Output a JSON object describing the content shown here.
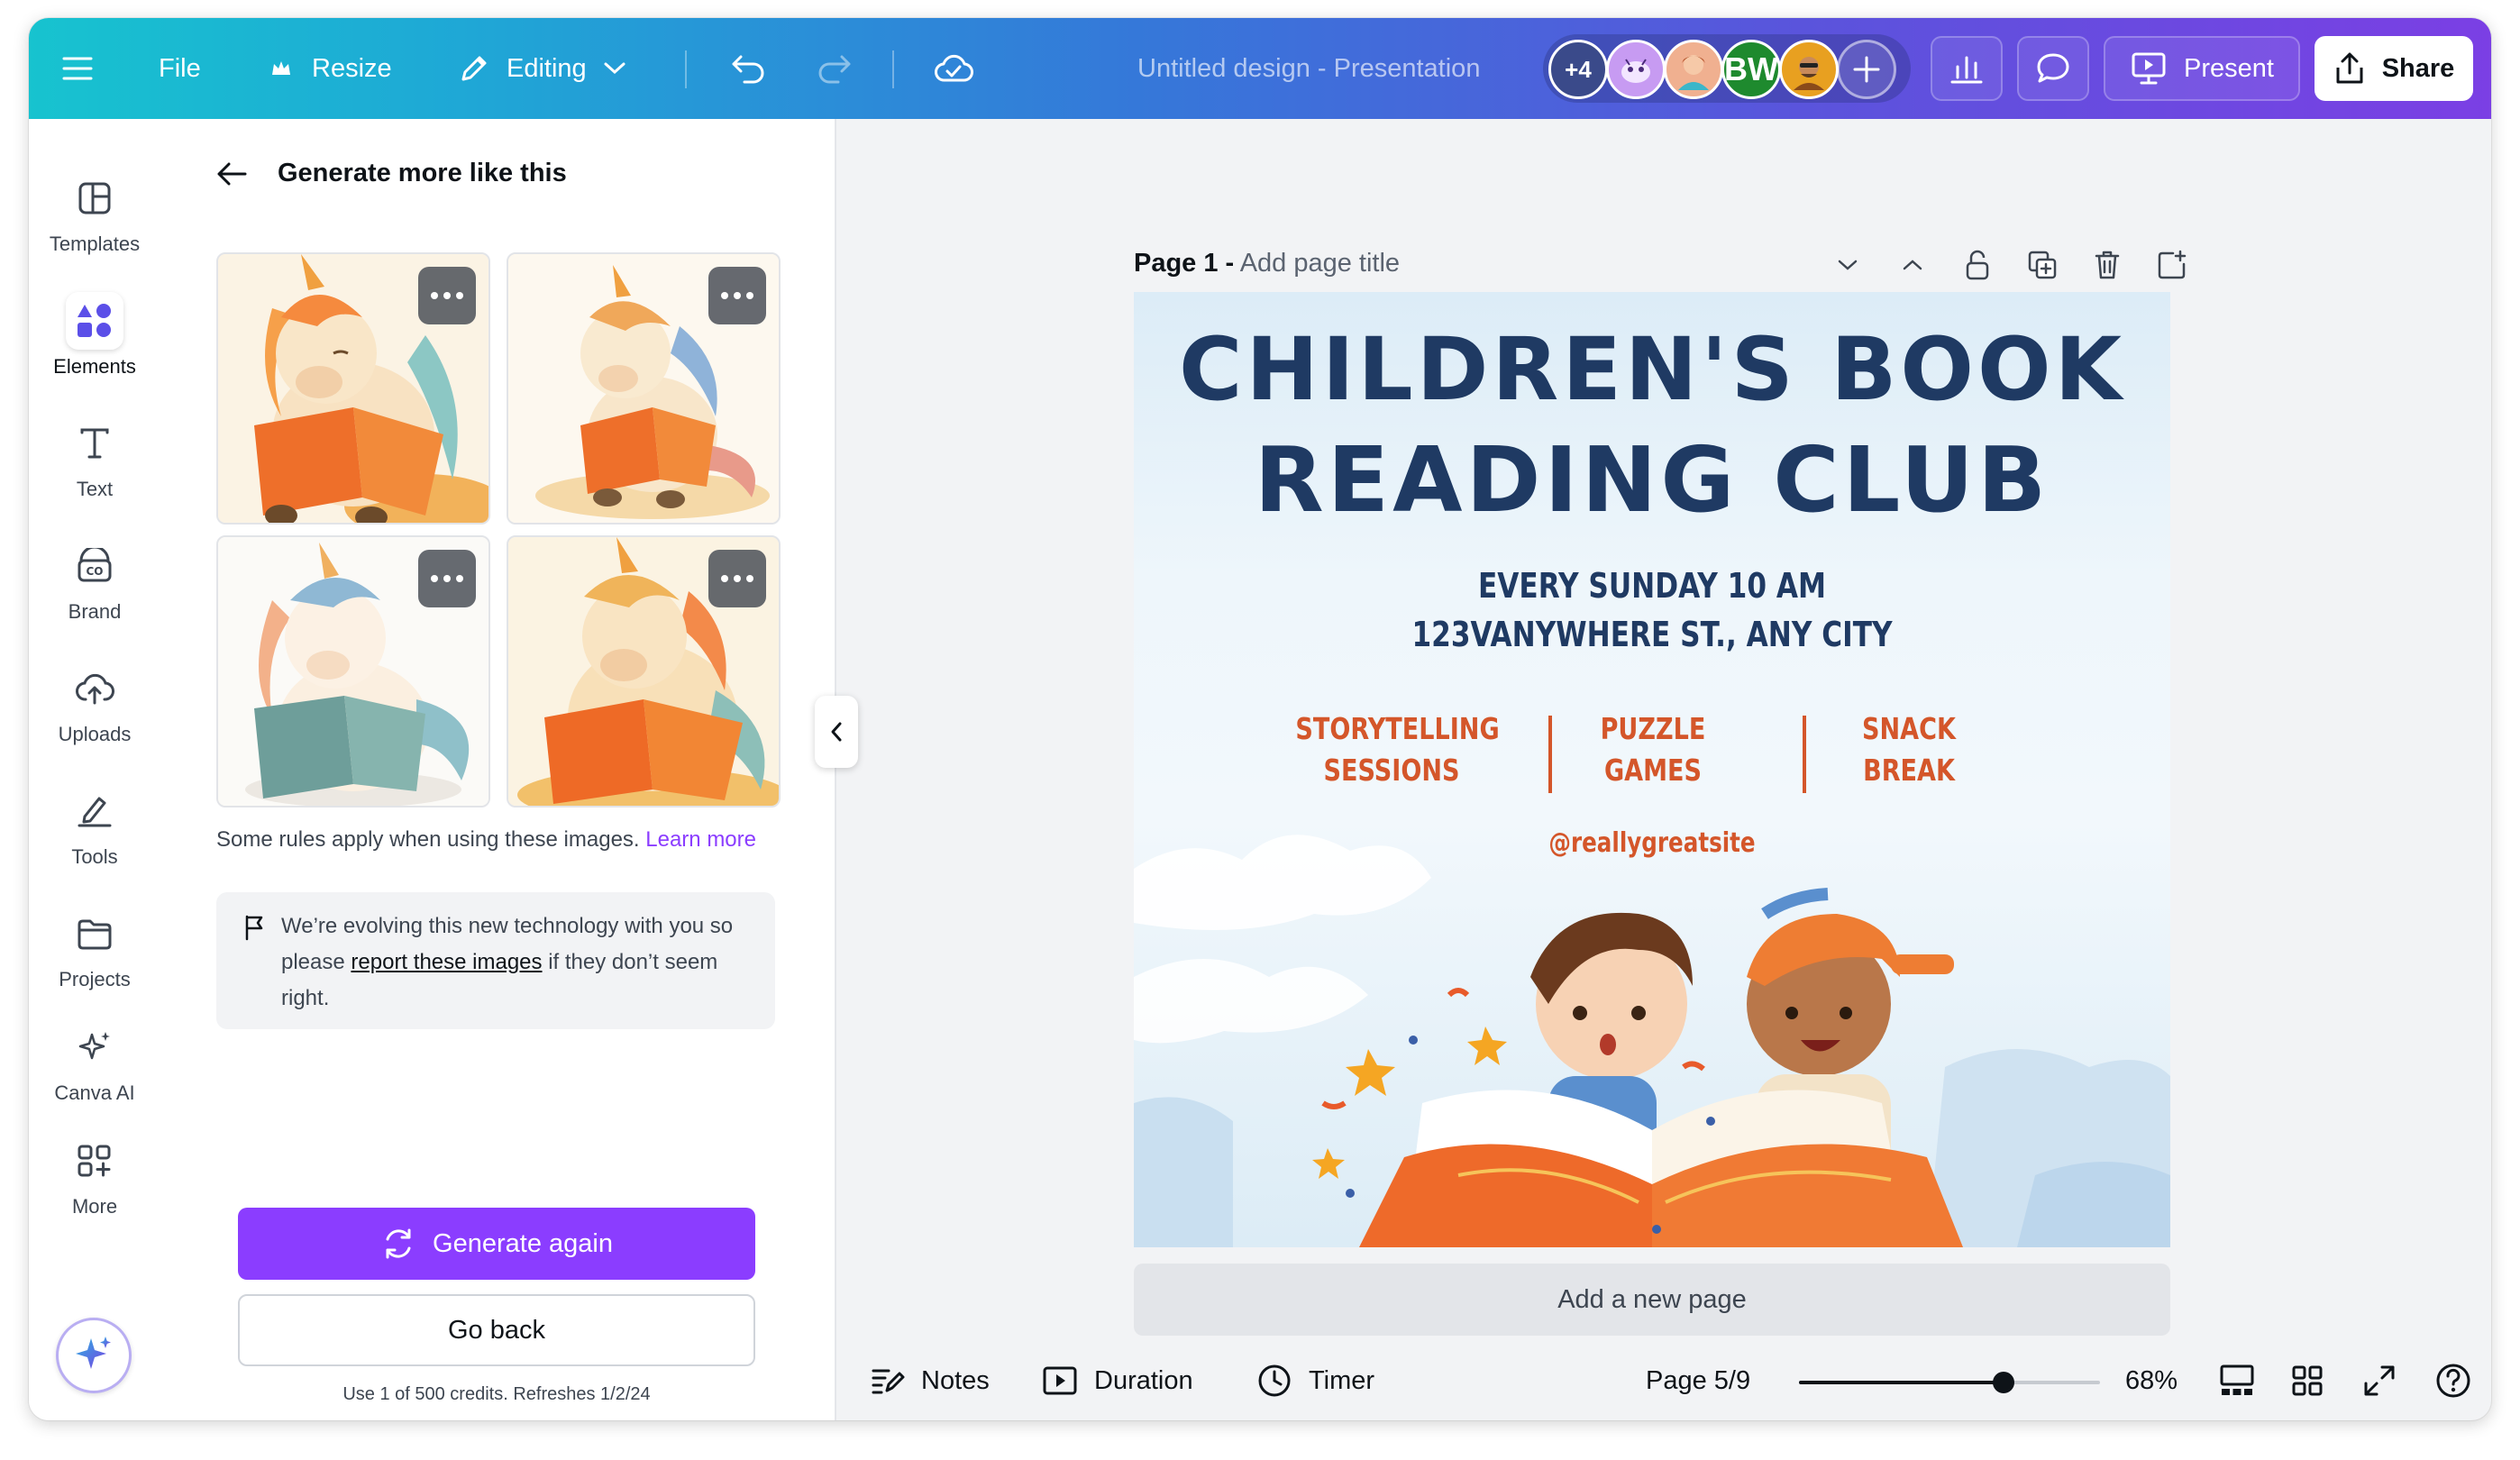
{
  "topbar": {
    "file_label": "File",
    "resize_label": "Resize",
    "editing_label": "Editing",
    "document_title": "Untitled design - Presentation",
    "collaborators_more": "+4",
    "avatar_initials": "BW",
    "present_label": "Present",
    "share_label": "Share"
  },
  "rail": {
    "items": [
      {
        "label": "Templates"
      },
      {
        "label": "Elements"
      },
      {
        "label": "Text"
      },
      {
        "label": "Brand"
      },
      {
        "label": "Uploads"
      },
      {
        "label": "Tools"
      },
      {
        "label": "Projects"
      },
      {
        "label": "Canva AI"
      },
      {
        "label": "More"
      }
    ]
  },
  "panel": {
    "heading": "Generate more like this",
    "rules_text": "Some rules apply when using these images.",
    "learn_more": "Learn more",
    "notice_1": "We’re evolving this new technology with you so please",
    "notice_link": "report these images",
    "notice_2": "if they don’t seem right.",
    "generate_again": "Generate again",
    "go_back": "Go back",
    "credits": "Use 1 of 500 credits. Refreshes 1/2/24"
  },
  "page": {
    "number_label": "Page 1 -",
    "title_placeholder": "Add page title"
  },
  "design": {
    "title_line1": "CHILDREN'S BOOK",
    "title_line2": "READING CLUB",
    "schedule": "EVERY SUNDAY 10 AM",
    "address": "123VANYWHERE ST., ANY CITY",
    "activity1_a": "STORYTELLING",
    "activity1_b": "SESSIONS",
    "activity2_a": "PUZZLE",
    "activity2_b": "GAMES",
    "activity3_a": "SNACK",
    "activity3_b": "BREAK",
    "handle": "@reallygreatsite"
  },
  "canvas": {
    "add_page": "Add a new page"
  },
  "bottombar": {
    "notes": "Notes",
    "duration": "Duration",
    "timer": "Timer",
    "page_indicator": "Page 5/9",
    "zoom": "68%",
    "zoom_fraction": 0.68
  },
  "colors": {
    "accent_purple": "#8b3dff",
    "navy": "#1f3a63",
    "orange": "#d4562a"
  }
}
